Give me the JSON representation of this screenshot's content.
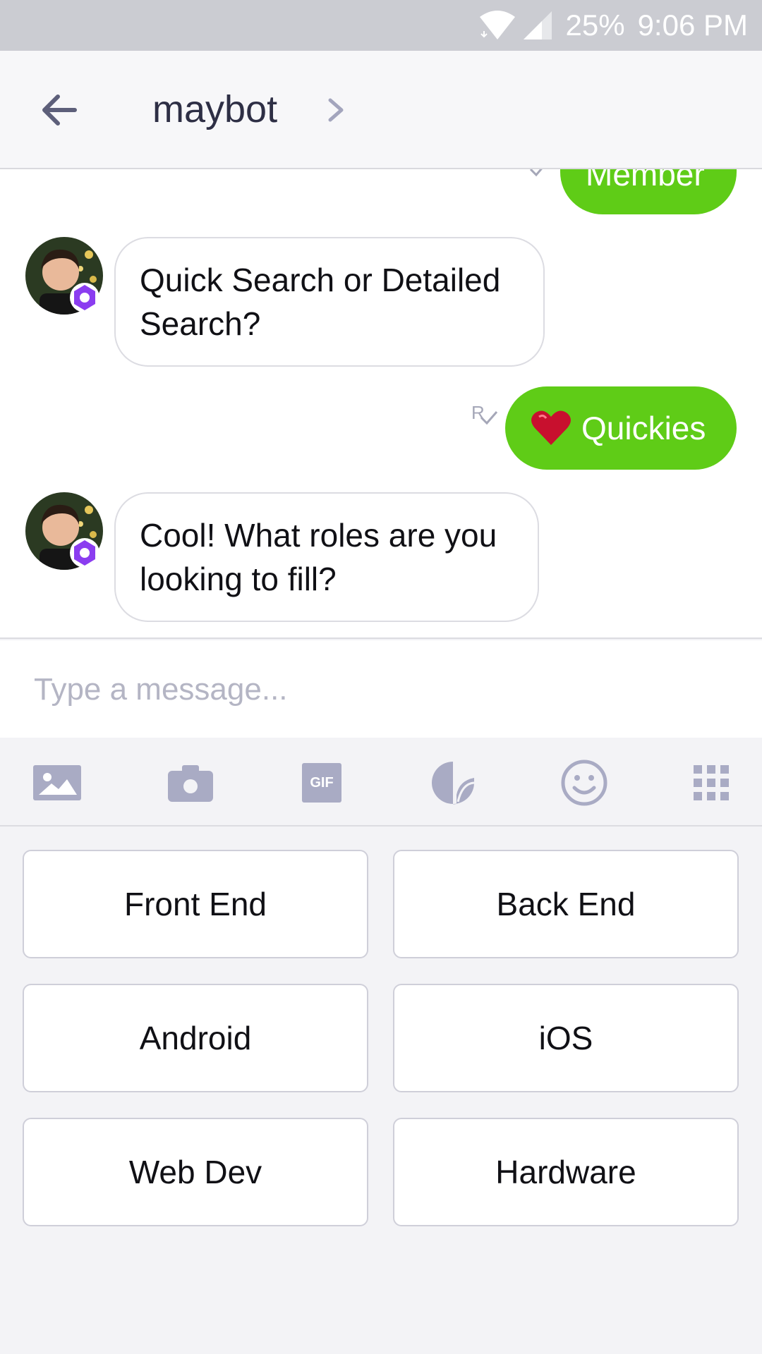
{
  "status_bar": {
    "battery": "25%",
    "time": "9:06 PM"
  },
  "header": {
    "title": "maybot"
  },
  "messages": [
    {
      "type": "out",
      "text": "Member"
    },
    {
      "type": "in",
      "text": "Quick Search or Detailed Search?"
    },
    {
      "type": "out",
      "text": "Quickies",
      "receipt": "R"
    },
    {
      "type": "in",
      "text": "Cool! What roles are you looking to fill?"
    }
  ],
  "composer": {
    "placeholder": "Type a message..."
  },
  "toolbar": {
    "gif_label": "GIF",
    "icons": [
      "image-icon",
      "camera-icon",
      "gif-icon",
      "sticker-icon",
      "emoji-icon",
      "apps-grid-icon"
    ]
  },
  "quick_replies": [
    "Front End",
    "Back End",
    "Android",
    "iOS",
    "Web Dev",
    "Hardware"
  ],
  "colors": {
    "accent_green": "#5fcc17",
    "badge_purple": "#8b3df0",
    "icon_gray": "#a9abc4"
  }
}
